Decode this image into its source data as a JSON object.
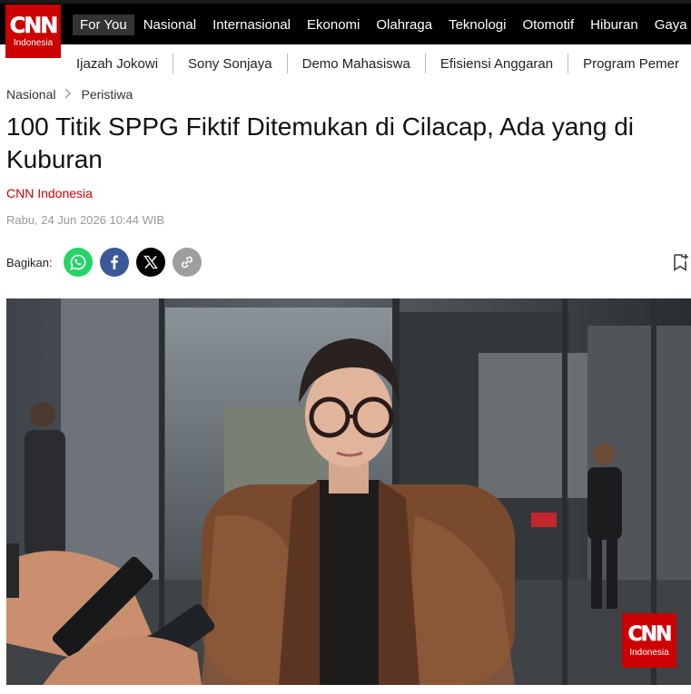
{
  "logo": {
    "word": "CNN",
    "sub": "Indonesia"
  },
  "nav": {
    "items": [
      {
        "label": "For You",
        "active": true
      },
      {
        "label": "Nasional"
      },
      {
        "label": "Internasional"
      },
      {
        "label": "Ekonomi"
      },
      {
        "label": "Olahraga"
      },
      {
        "label": "Teknologi"
      },
      {
        "label": "Otomotif"
      },
      {
        "label": "Hiburan"
      },
      {
        "label": "Gaya"
      }
    ]
  },
  "subnav": {
    "items": [
      "Ijazah Jokowi",
      "Sony Sonjaya",
      "Demo Mahasiswa",
      "Efisiensi Anggaran",
      "Program Pemer"
    ]
  },
  "breadcrumb": {
    "section": "Nasional",
    "subsection": "Peristiwa"
  },
  "article": {
    "title": "100 Titik SPPG Fiktif Ditemukan di Cilacap, Ada yang di Kuburan",
    "source": "CNN Indonesia",
    "date": "Rabu, 24 Jun 2026 10:44 WIB"
  },
  "share": {
    "label": "Bagikan:",
    "buttons": [
      {
        "icon": "whatsapp-icon",
        "color": "#25d366"
      },
      {
        "icon": "facebook-icon",
        "color": "#3b5998"
      },
      {
        "icon": "x-icon",
        "color": "#000000"
      },
      {
        "icon": "link-icon",
        "color": "#9e9e9e"
      }
    ]
  },
  "colors": {
    "brand": "#cc0000",
    "topbar": "#000000",
    "active_nav": "#333333"
  }
}
